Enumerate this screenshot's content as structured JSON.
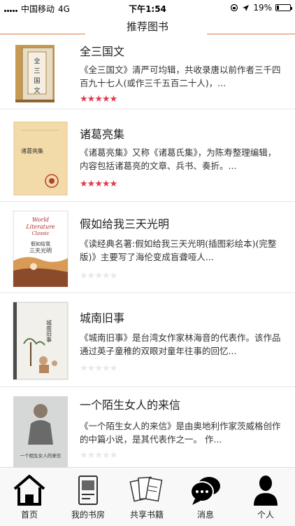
{
  "status_bar": {
    "carrier": "中国移动",
    "network": "4G",
    "time": "下午1:54",
    "battery": "19%",
    "battery_level": 0.19
  },
  "header": {
    "title": "推荐图书"
  },
  "books": [
    {
      "title": "全三国文",
      "description": "《全三国文》清严可均辑，共收录唐以前作者三千四百九十七人(或作三千五百二十人)，...",
      "rating": 5,
      "cover_text": "全三国文",
      "cover_color": "#b5823c"
    },
    {
      "title": "诸葛亮集",
      "description": "《诸葛亮集》又称《诸葛氏集》，为陈寿整理编辑，内容包括诸葛亮的文章、兵书、奏折。...",
      "rating": 5,
      "cover_text": "诸葛亮集",
      "cover_color": "#f3dcaa"
    },
    {
      "title": "假如给我三天光明",
      "description": "《读经典名著:假如给我三天光明(插图彩绘本)(完整版)》主要写了海伦变成盲聋哑人...",
      "rating": 0,
      "cover_text": "World Literature Classic 假如给我三天光明",
      "cover_color": "#ffffff"
    },
    {
      "title": "城南旧事",
      "description": "《城南旧事》是台湾女作家林海音的代表作。该作品通过英子童稚的双眼对童年往事的回忆...",
      "rating": 0,
      "cover_text": "城南旧事",
      "cover_color": "#f2f0ea"
    },
    {
      "title": "一个陌生女人的来信",
      "description": "《一个陌生女人的来信》是由奥地利作家茨威格创作的中篇小说，是其代表作之一。 作...",
      "rating": 0,
      "cover_text": "一个陌生女人的来信",
      "cover_color": "#d6d8d8"
    }
  ],
  "tabs": [
    {
      "label": "首页",
      "icon": "home-icon"
    },
    {
      "label": "我的书房",
      "icon": "book-icon"
    },
    {
      "label": "共享书籍",
      "icon": "shared-books-icon"
    },
    {
      "label": "消息",
      "icon": "message-icon"
    },
    {
      "label": "个人",
      "icon": "person-icon"
    }
  ],
  "colors": {
    "accent": "#e07b39",
    "star": "#e23a4d",
    "star_off": "#e8e8e8"
  }
}
